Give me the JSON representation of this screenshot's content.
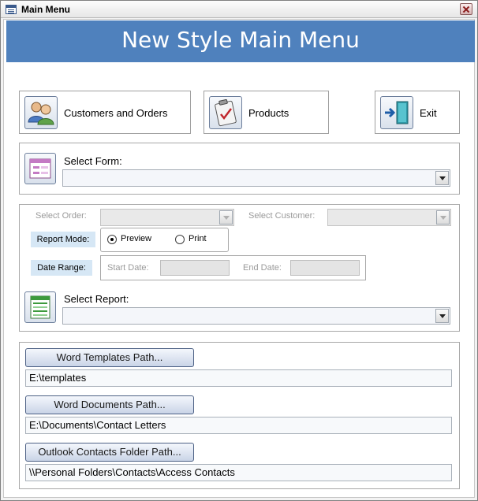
{
  "window": {
    "title": "Main Menu"
  },
  "header": {
    "title": "New Style Main Menu"
  },
  "buttons": {
    "customers_orders": "Customers and Orders",
    "products": "Products",
    "exit": "Exit"
  },
  "select_form": {
    "label": "Select Form:",
    "value": ""
  },
  "report": {
    "select_order_label": "Select Order:",
    "select_customer_label": "Select Customer:",
    "report_mode_label": "Report Mode:",
    "mode_options": [
      "Preview",
      "Print"
    ],
    "mode_selected": "Preview",
    "date_range_label": "Date Range:",
    "start_date_label": "Start Date:",
    "end_date_label": "End Date:",
    "select_report_label": "Select Report:"
  },
  "paths": {
    "word_templates_button": "Word Templates Path...",
    "word_templates_value": "E:\\templates",
    "word_documents_button": "Word Documents Path...",
    "word_documents_value": "E:\\Documents\\Contact Letters",
    "outlook_contacts_button": "Outlook Contacts Folder Path...",
    "outlook_contacts_value": "\\\\Personal Folders\\Contacts\\Access Contacts"
  },
  "colors": {
    "header_bg": "#4f81bd",
    "label_bg": "#d6e7f5"
  }
}
